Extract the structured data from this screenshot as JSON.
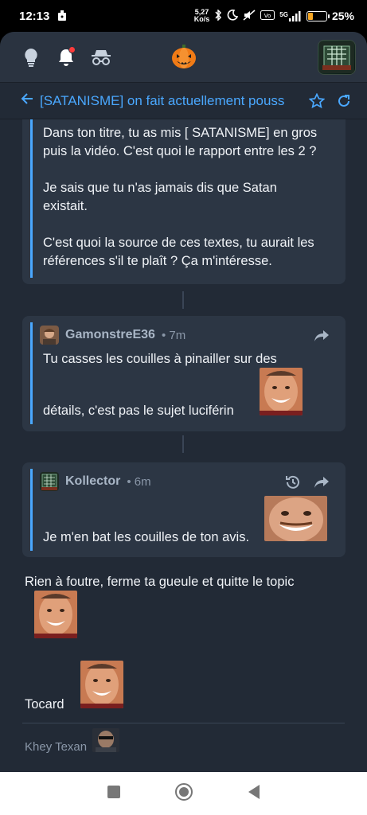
{
  "status": {
    "time": "12:13",
    "net_speed_top": "5,27",
    "net_speed_unit": "Ko/s",
    "network": "5G",
    "battery_pct": "25%",
    "battery_level": 0.25
  },
  "header": {
    "bulb_icon": "bulb-icon",
    "bell_icon": "bell-icon",
    "incognito_icon": "incognito-icon",
    "logo_icon": "pumpkin-icon"
  },
  "topic": {
    "title": "[SATANISME] on fait actuellement pouss"
  },
  "posts": {
    "first": {
      "lines": [
        "Dans ton titre, tu as mis [ SATANISME] en gros",
        "puis la vidéo. C'est quoi le rapport entre les 2 ?",
        "Je sais que tu n'as jamais dis que Satan",
        "existait.",
        "C'est quoi la source de ces textes, tu aurait les",
        "références s'il te plaît ? Ça m'intéresse."
      ]
    },
    "second": {
      "author": "GamonstreE36",
      "time": "• 7m",
      "line1": "Tu casses les couilles à pinailler sur des",
      "line2": "détails, c'est pas le sujet luciférin"
    },
    "third": {
      "author": "Kollector",
      "time": "• 6m",
      "line1": "Je m'en bat les couilles de ton avis."
    },
    "reply": {
      "line1": "Rien à foutre, ferme ta gueule et quitte le topic",
      "line2": "Tocard",
      "signature": "Khey Texan"
    }
  }
}
